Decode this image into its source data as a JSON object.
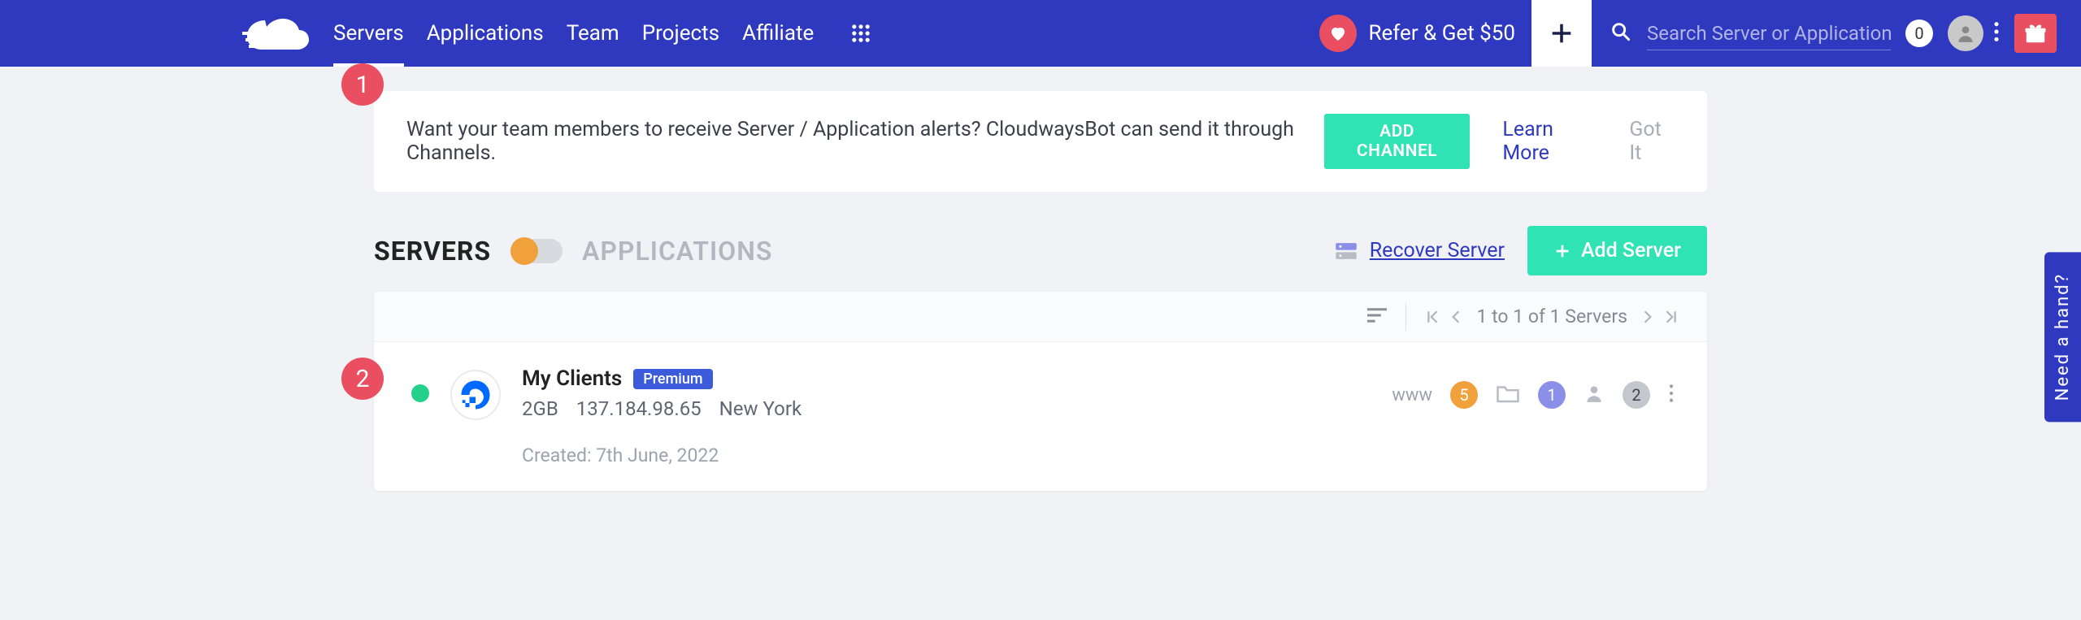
{
  "nav": {
    "servers": "Servers",
    "applications": "Applications",
    "team": "Team",
    "projects": "Projects",
    "affiliate": "Affiliate"
  },
  "refer_label": "Refer & Get $50",
  "search": {
    "placeholder": "Search Server or Application"
  },
  "notif_count": "0",
  "banner": {
    "text": "Want your team members to receive Server / Application alerts? CloudwaysBot can send it through Channels.",
    "add_channel": "ADD CHANNEL",
    "learn_more": "Learn More",
    "got_it": "Got It"
  },
  "segments": {
    "servers": "SERVERS",
    "applications": "APPLICATIONS"
  },
  "actions": {
    "recover": "Recover Server",
    "add_server": "Add Server"
  },
  "pager": {
    "text": "1 to 1 of 1 Servers"
  },
  "server": {
    "name": "My Clients",
    "badge": "Premium",
    "size": "2GB",
    "ip": "137.184.98.65",
    "region": "New York",
    "created": "Created: 7th June, 2022",
    "www_count": "5",
    "project_count": "1",
    "user_count": "2",
    "www_label": "www"
  },
  "annotations": {
    "one": "1",
    "two": "2"
  },
  "side_tab": "Need a hand?"
}
